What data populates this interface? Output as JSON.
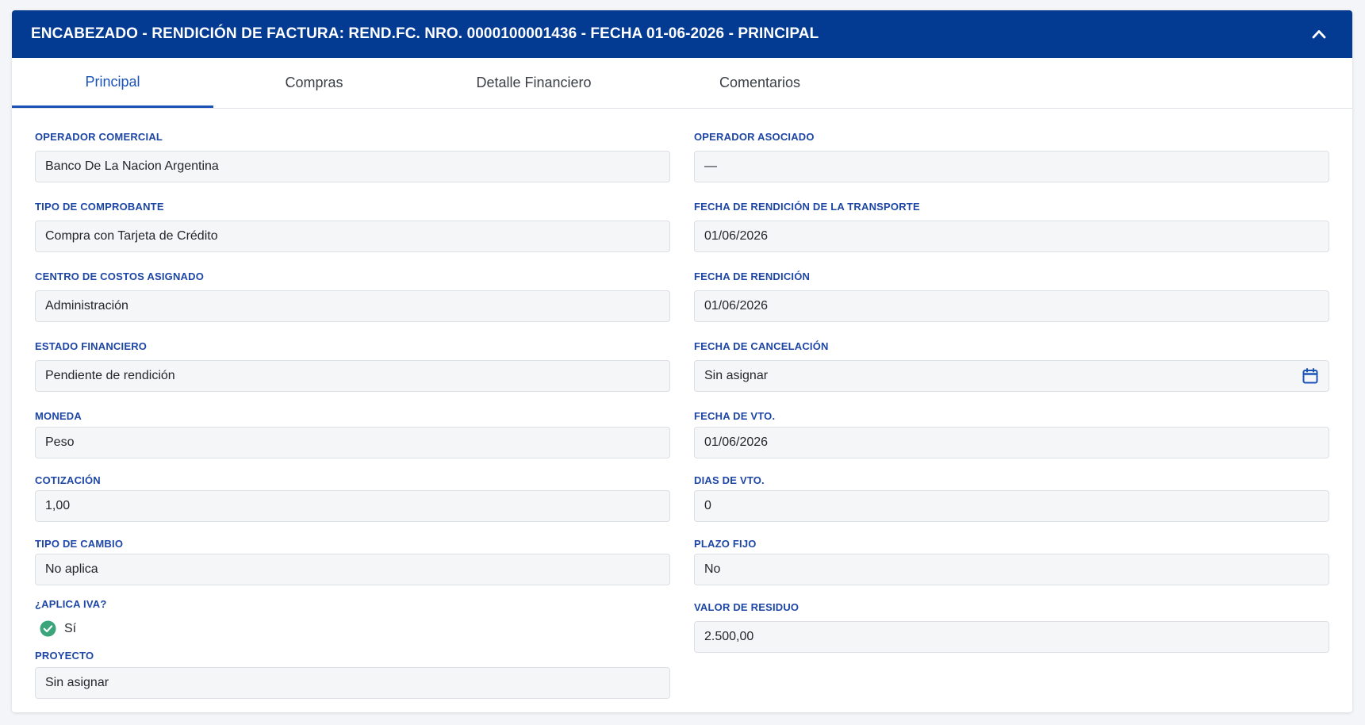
{
  "header": {
    "title": "ENCABEZADO - RENDICIÓN DE FACTURA: REND.FC. NRO. 0000100001436 - FECHA 01-06-2026 - PRINCIPAL",
    "collapse_icon": "chevron-up-icon"
  },
  "tabs": [
    {
      "label": "Principal",
      "active": true
    },
    {
      "label": "Compras",
      "active": false
    },
    {
      "label": "Detalle Financiero",
      "active": false
    },
    {
      "label": "Comentarios",
      "active": false
    }
  ],
  "left": {
    "operador_comercial": {
      "label": "OPERADOR COMERCIAL",
      "value": "Banco De La Nacion Argentina"
    },
    "tipo_comprobante": {
      "label": "TIPO DE COMPROBANTE",
      "value": "Compra con Tarjeta de Crédito"
    },
    "centro_costos": {
      "label": "CENTRO DE COSTOS ASIGNADO",
      "value": "Administración"
    },
    "estado_financiero": {
      "label": "ESTADO FINANCIERO",
      "value": "Pendiente de rendición"
    },
    "moneda": {
      "label": "MONEDA",
      "value": "Peso"
    },
    "cotizacion": {
      "label": "COTIZACIÓN",
      "value": "1,00"
    },
    "tipo_cambio": {
      "label": "TIPO DE CAMBIO",
      "value": "No aplica"
    },
    "aplica_iva": {
      "label": "¿APLICA IVA?",
      "value": "Sí"
    },
    "proyecto": {
      "label": "PROYECTO",
      "value": "Sin asignar"
    }
  },
  "right": {
    "operador_asociado": {
      "label": "OPERADOR ASOCIADO",
      "value": "—"
    },
    "fecha_rendicion_transporte": {
      "label": "FECHA DE RENDICIÓN DE LA TRANSPORTE",
      "value": "01/06/2026"
    },
    "fecha_rendicion": {
      "label": "FECHA DE RENDICIÓN",
      "value": "01/06/2026"
    },
    "fecha_cancelacion": {
      "label": "FECHA DE CANCELACIÓN",
      "value": "Sin asignar"
    },
    "fecha_vto": {
      "label": "FECHA DE VTO.",
      "value": "01/06/2026"
    },
    "dias_vto": {
      "label": "DIAS DE VTO.",
      "value": "0"
    },
    "plazo_fijo": {
      "label": "PLAZO FIJO",
      "value": "No"
    },
    "valor_residuo": {
      "label": "VALOR DE RESIDUO",
      "value": "2.500,00"
    }
  },
  "colors": {
    "header_bg": "#033b93",
    "accent": "#1a52b8",
    "label": "#1d46a6",
    "check": "#3aa57a"
  }
}
